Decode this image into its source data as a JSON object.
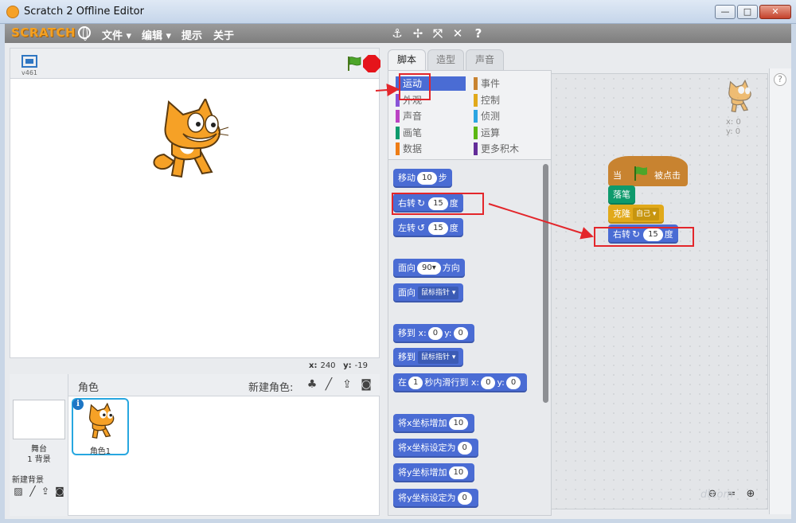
{
  "window": {
    "title": "Scratch 2 Offline Editor",
    "minimize": "—",
    "maximize": "□",
    "close": "✕"
  },
  "menubar": {
    "logo": "SCRATCH",
    "items": [
      "文件 ▾",
      "编辑 ▾",
      "提示",
      "关于"
    ],
    "tools": [
      "duplicate-icon",
      "delete-icon",
      "grow-icon",
      "shrink-icon",
      "help-icon"
    ]
  },
  "stage": {
    "version": "v461",
    "coords": {
      "x_label": "x:",
      "x": "240",
      "y_label": "y:",
      "y": "-19"
    }
  },
  "sprites": {
    "title": "角色",
    "new_sprite_label": "新建角色:",
    "stage_name": "舞台",
    "stage_count": "1 背景",
    "new_backdrop_label": "新建背景",
    "sprite_name": "角色1",
    "info": "i"
  },
  "tabs": [
    "脚本",
    "造型",
    "声音"
  ],
  "categories": [
    {
      "label": "运动",
      "color": "#4a6cd4"
    },
    {
      "label": "事件",
      "color": "#c88330"
    },
    {
      "label": "外观",
      "color": "#8a55d7"
    },
    {
      "label": "控制",
      "color": "#e1a91a"
    },
    {
      "label": "声音",
      "color": "#bb42c3"
    },
    {
      "label": "侦测",
      "color": "#2ca5e2"
    },
    {
      "label": "画笔",
      "color": "#0e9a6c"
    },
    {
      "label": "运算",
      "color": "#5cb712"
    },
    {
      "label": "数据",
      "color": "#ee7d16"
    },
    {
      "label": "更多积木",
      "color": "#632d99"
    }
  ],
  "palette": {
    "move": {
      "pre": "移动",
      "val": "10",
      "post": "步"
    },
    "turn_right": {
      "pre": "右转",
      "val": "15",
      "post": "度"
    },
    "turn_left": {
      "pre": "左转",
      "val": "15",
      "post": "度"
    },
    "point_dir": {
      "pre": "面向",
      "val": "90▾",
      "post": "方向"
    },
    "point_towards": {
      "pre": "面向",
      "dd": "鼠标指针 ▾"
    },
    "goto_xy": {
      "pre": "移到 x:",
      "x": "0",
      "mid": "y:",
      "y": "0"
    },
    "goto": {
      "pre": "移到",
      "dd": "鼠标指针 ▾"
    },
    "glide": {
      "pre": "在",
      "secs": "1",
      "mid": "秒内滑行到 x:",
      "x": "0",
      "mid2": "y:",
      "y": "0"
    },
    "change_x": {
      "pre": "将x坐标增加",
      "val": "10"
    },
    "set_x": {
      "pre": "将x坐标设定为",
      "val": "0"
    },
    "change_y": {
      "pre": "将y坐标增加",
      "val": "10"
    },
    "set_y": {
      "pre": "将y坐标设定为",
      "val": "0"
    }
  },
  "script": {
    "hat_pre": "当",
    "hat_post": "被点击",
    "pen_down": "落笔",
    "clone": {
      "pre": "克隆",
      "dd": "自己 ▾"
    },
    "turn_right": {
      "pre": "右转",
      "val": "15",
      "post": "度"
    },
    "sprite_x": "x: 0",
    "sprite_y": "y: 0"
  },
  "zoom": [
    "zoom-out-icon",
    "zoom-reset-icon",
    "zoom-in-icon"
  ],
  "help": "?",
  "watermark": "dtcom"
}
